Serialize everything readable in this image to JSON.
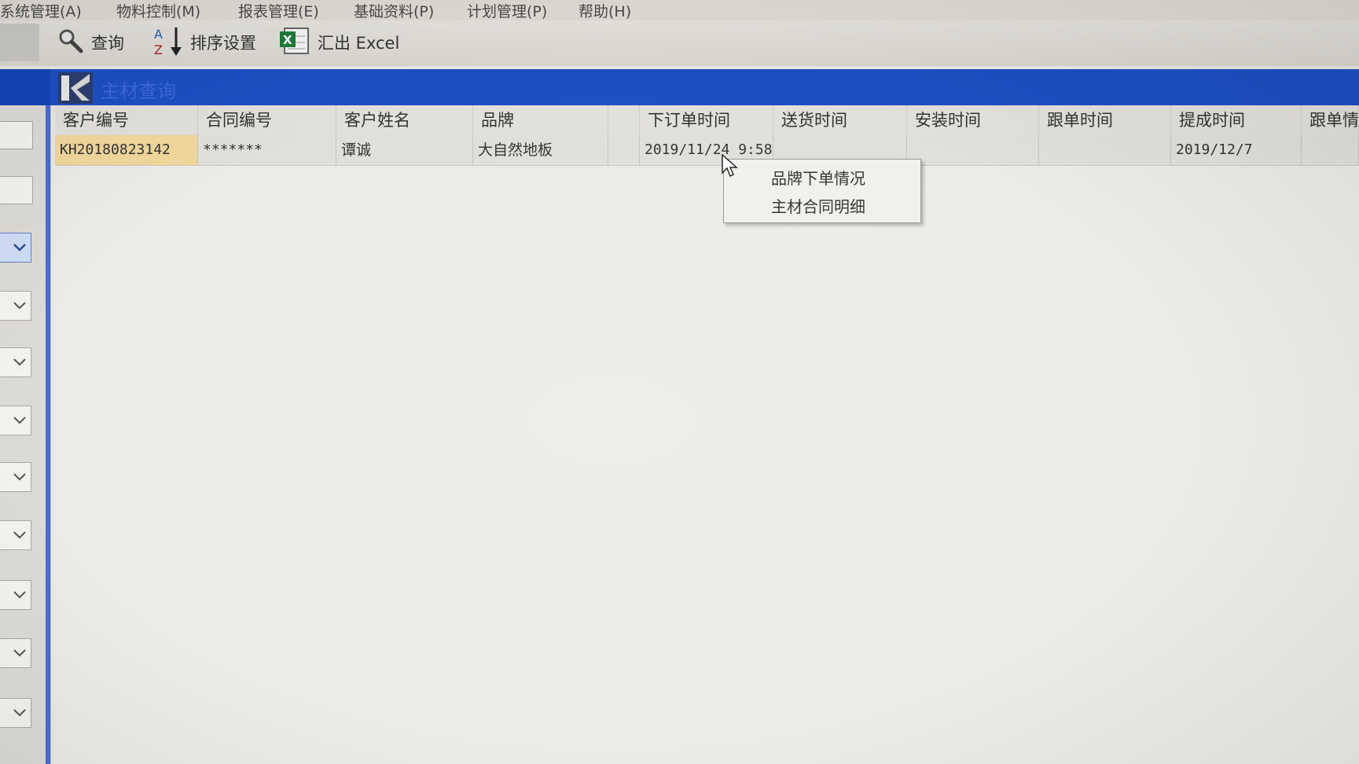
{
  "menu": [
    "系统管理(A)",
    "物料控制(M)",
    "报表管理(E)",
    "基础资料(P)",
    "计划管理(P)",
    "帮助(H)"
  ],
  "toolbar": {
    "query_label": "查询",
    "sort_label": "排序设置",
    "export_label": "汇出 Excel"
  },
  "window": {
    "title": "主材查询"
  },
  "table": {
    "columns": [
      "客户编号",
      "合同编号",
      "客户姓名",
      "品牌",
      "",
      "下订单时间",
      "送货时间",
      "安装时间",
      "跟单时间",
      "提成时间",
      "跟单情况"
    ],
    "rows": [
      [
        "KH20180823142",
        "*******",
        "谭诚",
        "大自然地板",
        "",
        "2019/11/24 9:58",
        "",
        "",
        "",
        "2019/12/7",
        ""
      ]
    ]
  },
  "context_menu": {
    "items": [
      "品牌下单情况",
      "主材合同明细"
    ]
  },
  "colors": {
    "title_bar": "#1d4fc2",
    "selected_cell": "#f0d79c"
  }
}
